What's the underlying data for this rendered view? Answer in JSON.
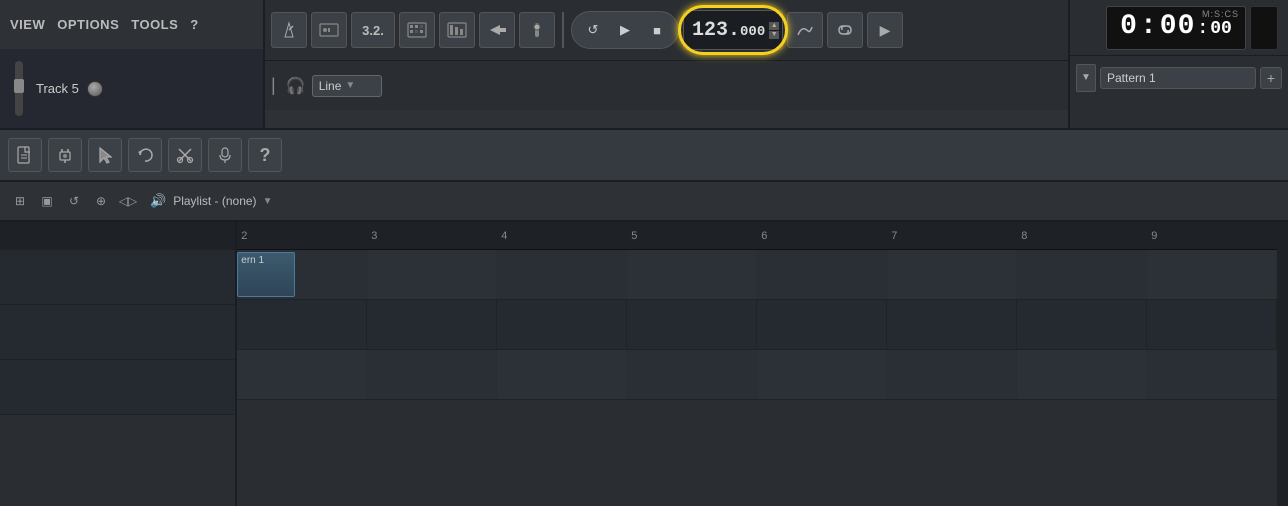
{
  "menu": {
    "items": [
      "VIEW",
      "OPTIONS",
      "TOOLS",
      "?"
    ]
  },
  "track": {
    "name": "Track 5"
  },
  "controls": {
    "bpm": "123",
    "bpm_decimal": "000",
    "time_format": "M:S:CS",
    "time_hours": "0",
    "time_minutes": "00",
    "time_seconds": "00",
    "pattern_name": "Pattern 1",
    "line_label": "Line",
    "playlist_label": "Playlist - (none)"
  },
  "transport": {
    "loop_label": "↺",
    "play_label": "▶",
    "stop_label": "■"
  },
  "toolbar_icons": {
    "new": "📄",
    "plugin": "⚡",
    "cursor": "↖",
    "undo": "↺",
    "cut": "✂",
    "mic": "🎤",
    "help": "?"
  },
  "playlist_icons": {
    "snap": "⊞",
    "select": "▣",
    "loop_range": "↺",
    "zoom": "🔍",
    "volume": "◁▷"
  },
  "timeline": {
    "numbers": [
      "2",
      "3",
      "4",
      "5",
      "6",
      "7",
      "8",
      "9"
    ]
  },
  "grid": {
    "rows": 3,
    "cells_per_row": 9
  },
  "pattern_block": {
    "label": "ern 1"
  }
}
